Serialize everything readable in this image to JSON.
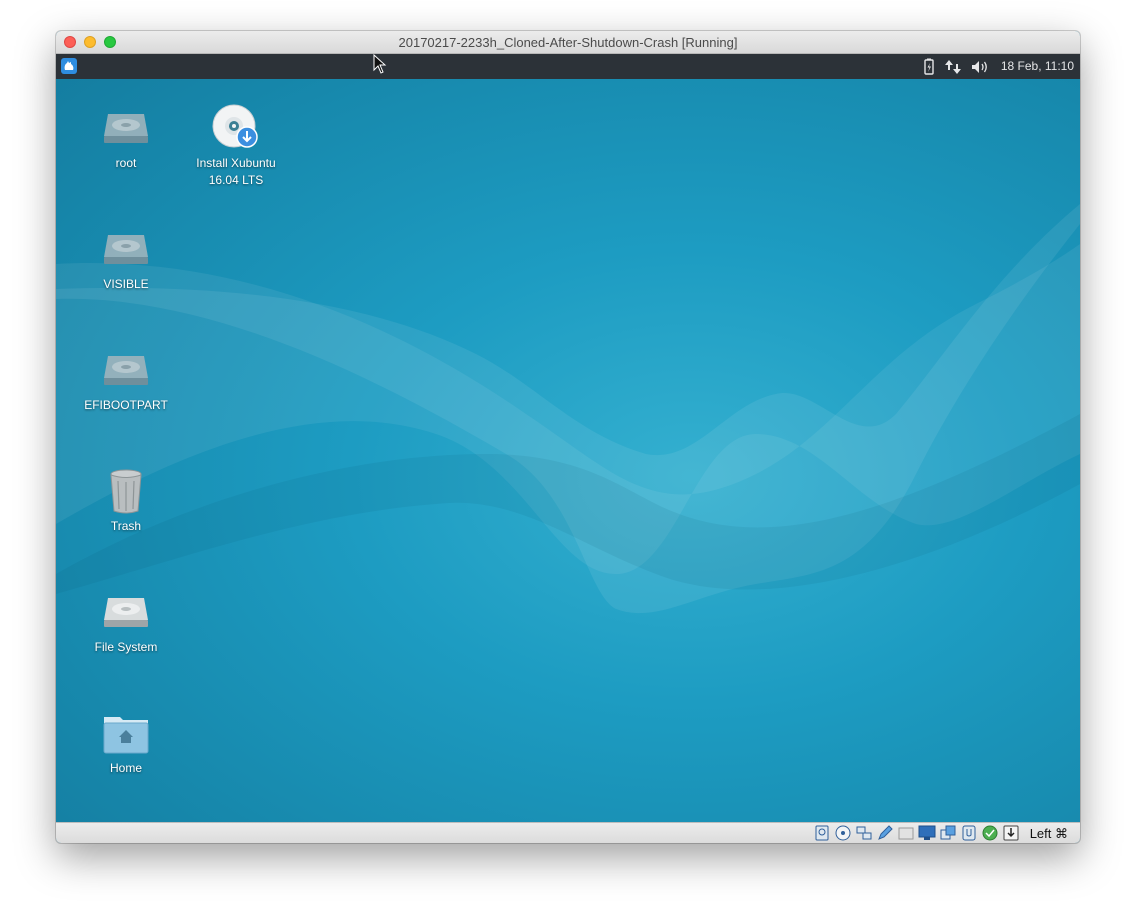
{
  "window": {
    "title": "20170217-2233h_Cloned-After-Shutdown-Crash [Running]"
  },
  "panel": {
    "menu_icon": "xubuntu-whisker-menu-icon",
    "tray": [
      "battery-icon",
      "network-updown-icon",
      "volume-icon"
    ],
    "clock": "18 Feb, 11:10"
  },
  "desktop": {
    "icons": [
      {
        "label": "root",
        "icon": "drive-icon"
      },
      {
        "label": "Install Xubuntu 16.04 LTS",
        "icon": "installer-disc-icon"
      },
      {
        "label": "VISIBLE",
        "icon": "drive-icon"
      },
      {
        "label": "EFIBOOTPART",
        "icon": "drive-icon"
      },
      {
        "label": "Trash",
        "icon": "trash-icon"
      },
      {
        "label": "File System",
        "icon": "harddisk-icon"
      },
      {
        "label": "Home",
        "icon": "home-folder-icon"
      }
    ]
  },
  "statusbar": {
    "icons": [
      "hard-disk-icon",
      "optical-drive-icon",
      "network-icon",
      "pen-icon",
      "shared-folder-icon",
      "display-icon",
      "video-capture-icon",
      "usb-icon",
      "guest-additions-icon",
      "mouse-integration-icon"
    ],
    "host_key": "Left ⌘"
  },
  "colors": {
    "desktop": "#1b8db3",
    "panel": "#2c3238",
    "whisker": "#2e8de0"
  }
}
